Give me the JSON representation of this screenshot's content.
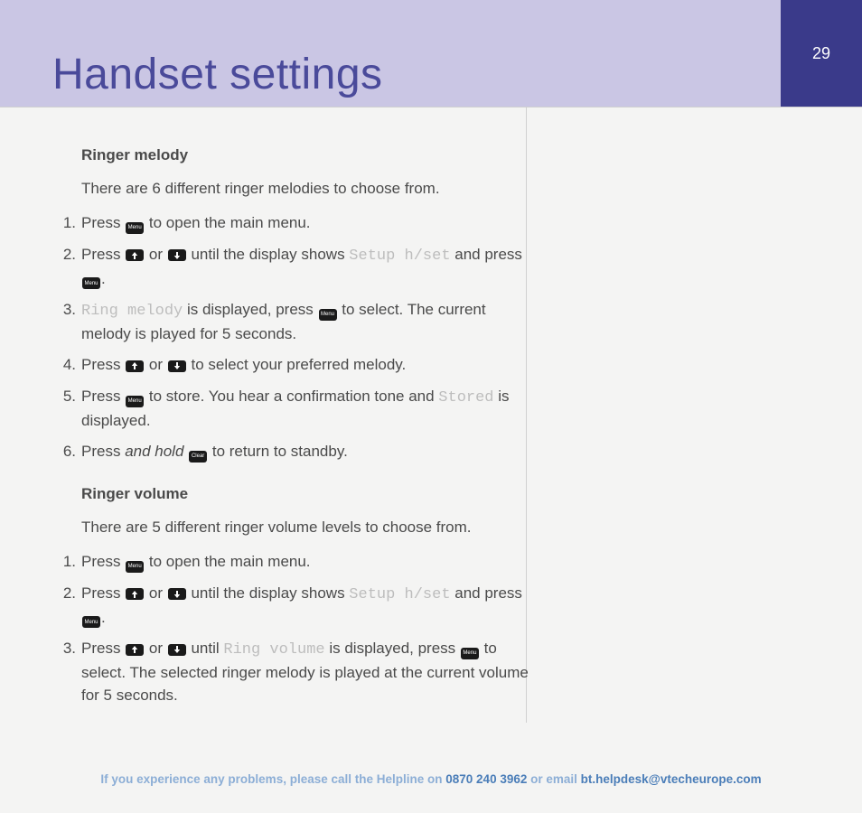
{
  "header": {
    "title": "Handset settings",
    "page_number": "29"
  },
  "keys": {
    "menu": "Menu",
    "clear": "Clear"
  },
  "sections": [
    {
      "heading": "Ringer melody",
      "intro": "There are 6 different ringer melodies to choose from.",
      "steps": [
        {
          "num": "1.",
          "parts": [
            {
              "t": "text",
              "v": "Press "
            },
            {
              "t": "key",
              "v": "menu"
            },
            {
              "t": "text",
              "v": " to open the main menu."
            }
          ]
        },
        {
          "num": "2.",
          "parts": [
            {
              "t": "text",
              "v": "Press "
            },
            {
              "t": "key",
              "v": "up"
            },
            {
              "t": "text",
              "v": " or "
            },
            {
              "t": "key",
              "v": "down"
            },
            {
              "t": "text",
              "v": " until the display shows "
            },
            {
              "t": "lcd",
              "v": "Setup h/set"
            },
            {
              "t": "text",
              "v": " and press "
            },
            {
              "t": "key",
              "v": "menu"
            },
            {
              "t": "text",
              "v": "."
            }
          ]
        },
        {
          "num": "3.",
          "parts": [
            {
              "t": "lcd",
              "v": "Ring melody"
            },
            {
              "t": "text",
              "v": " is displayed, press "
            },
            {
              "t": "key",
              "v": "menu"
            },
            {
              "t": "text",
              "v": " to select. The current melody is played for 5 seconds."
            }
          ]
        },
        {
          "num": "4.",
          "parts": [
            {
              "t": "text",
              "v": "Press "
            },
            {
              "t": "key",
              "v": "up"
            },
            {
              "t": "text",
              "v": " or "
            },
            {
              "t": "key",
              "v": "down"
            },
            {
              "t": "text",
              "v": " to select your preferred melody."
            }
          ]
        },
        {
          "num": "5.",
          "parts": [
            {
              "t": "text",
              "v": "Press "
            },
            {
              "t": "key",
              "v": "menu"
            },
            {
              "t": "text",
              "v": " to store. You hear a confirmation tone and "
            },
            {
              "t": "lcd",
              "v": "Stored"
            },
            {
              "t": "text",
              "v": " is displayed."
            }
          ]
        },
        {
          "num": "6.",
          "parts": [
            {
              "t": "text",
              "v": "Press "
            },
            {
              "t": "italic",
              "v": "and hold "
            },
            {
              "t": "key",
              "v": "clear"
            },
            {
              "t": "text",
              "v": " to return to standby."
            }
          ]
        }
      ]
    },
    {
      "heading": "Ringer volume",
      "intro": "There are 5 different ringer volume levels to choose from.",
      "steps": [
        {
          "num": "1.",
          "parts": [
            {
              "t": "text",
              "v": "Press "
            },
            {
              "t": "key",
              "v": "menu"
            },
            {
              "t": "text",
              "v": " to open the main menu."
            }
          ]
        },
        {
          "num": "2.",
          "parts": [
            {
              "t": "text",
              "v": "Press "
            },
            {
              "t": "key",
              "v": "up"
            },
            {
              "t": "text",
              "v": " or "
            },
            {
              "t": "key",
              "v": "down"
            },
            {
              "t": "text",
              "v": " until the display shows "
            },
            {
              "t": "lcd",
              "v": "Setup h/set"
            },
            {
              "t": "text",
              "v": " and press "
            },
            {
              "t": "key",
              "v": "menu"
            },
            {
              "t": "text",
              "v": "."
            }
          ]
        },
        {
          "num": "3.",
          "parts": [
            {
              "t": "text",
              "v": "Press "
            },
            {
              "t": "key",
              "v": "up"
            },
            {
              "t": "text",
              "v": " or "
            },
            {
              "t": "key",
              "v": "down"
            },
            {
              "t": "text",
              "v": " until "
            },
            {
              "t": "lcd",
              "v": "Ring volume"
            },
            {
              "t": "text",
              "v": " is displayed, press "
            },
            {
              "t": "key",
              "v": "menu"
            },
            {
              "t": "text",
              "v": " to select. The selected ringer melody is played at the current volume for 5 seconds."
            }
          ]
        }
      ]
    }
  ],
  "footer": {
    "prefix": "If you experience any problems, please call the Helpline on ",
    "phone": "0870 240 3962",
    "middle": " or email ",
    "email": "bt.helpdesk@vtecheurope.com"
  }
}
